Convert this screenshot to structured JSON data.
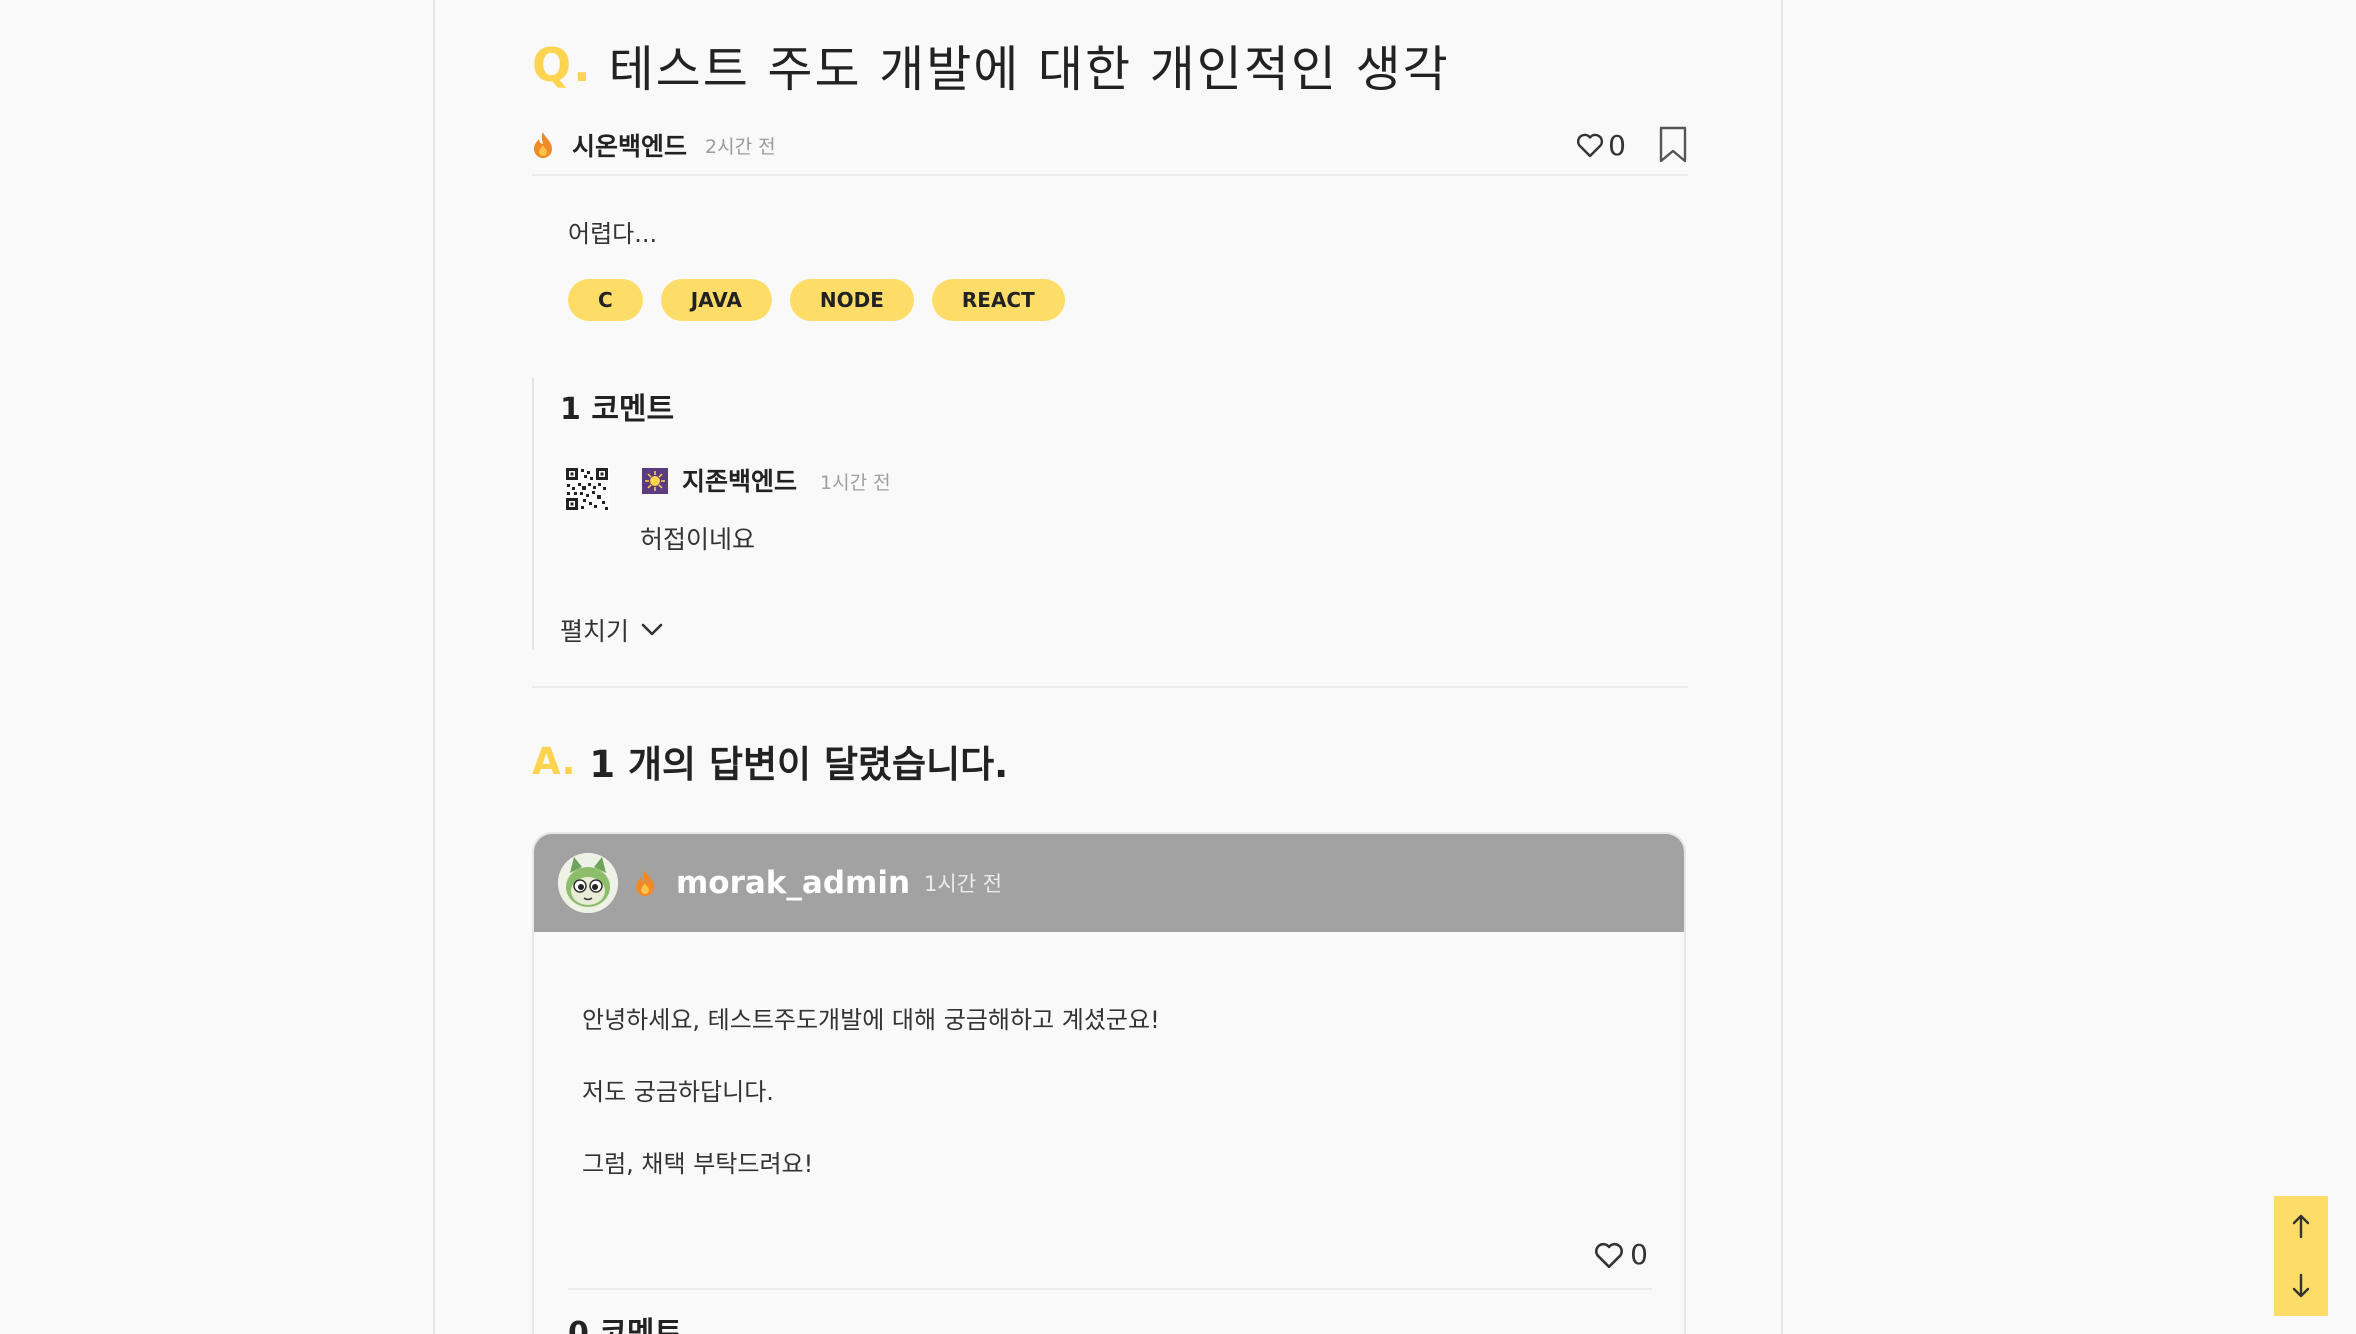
{
  "question": {
    "prefix": "Q.",
    "title": "테스트 주도 개발에 대한 개인적인 생각",
    "author": "시온백엔드",
    "time": "2시간 전",
    "like_count": "0",
    "body": "어렵다...",
    "tags": [
      "C",
      "JAVA",
      "NODE",
      "REACT"
    ]
  },
  "comments": {
    "title": "1 코멘트",
    "items": [
      {
        "author": "지존백엔드",
        "time": "1시간 전",
        "body": "허접이네요"
      }
    ],
    "expand_label": "펼치기"
  },
  "answers": {
    "prefix": "A.",
    "title": "1 개의 답변이 달렸습니다.",
    "items": [
      {
        "author": "morak_admin",
        "time": "1시간 전",
        "lines": [
          "안녕하세요, 테스트주도개발에 대해 궁금해하고 계셨군요!",
          "저도 궁금하답니다.",
          "그럼, 채택 부탁드려요!"
        ],
        "like_count": "0",
        "comments_title": "0 코멘트"
      }
    ]
  },
  "colors": {
    "accent": "#fdd44f",
    "tag_bg": "#fddd67",
    "card_header": "#a2a2a2",
    "flame": "#f08a24"
  },
  "icons": [
    "flame-icon",
    "heart-icon",
    "bookmark-icon",
    "chevron-down-icon",
    "arrow-up-icon",
    "arrow-down-icon"
  ]
}
